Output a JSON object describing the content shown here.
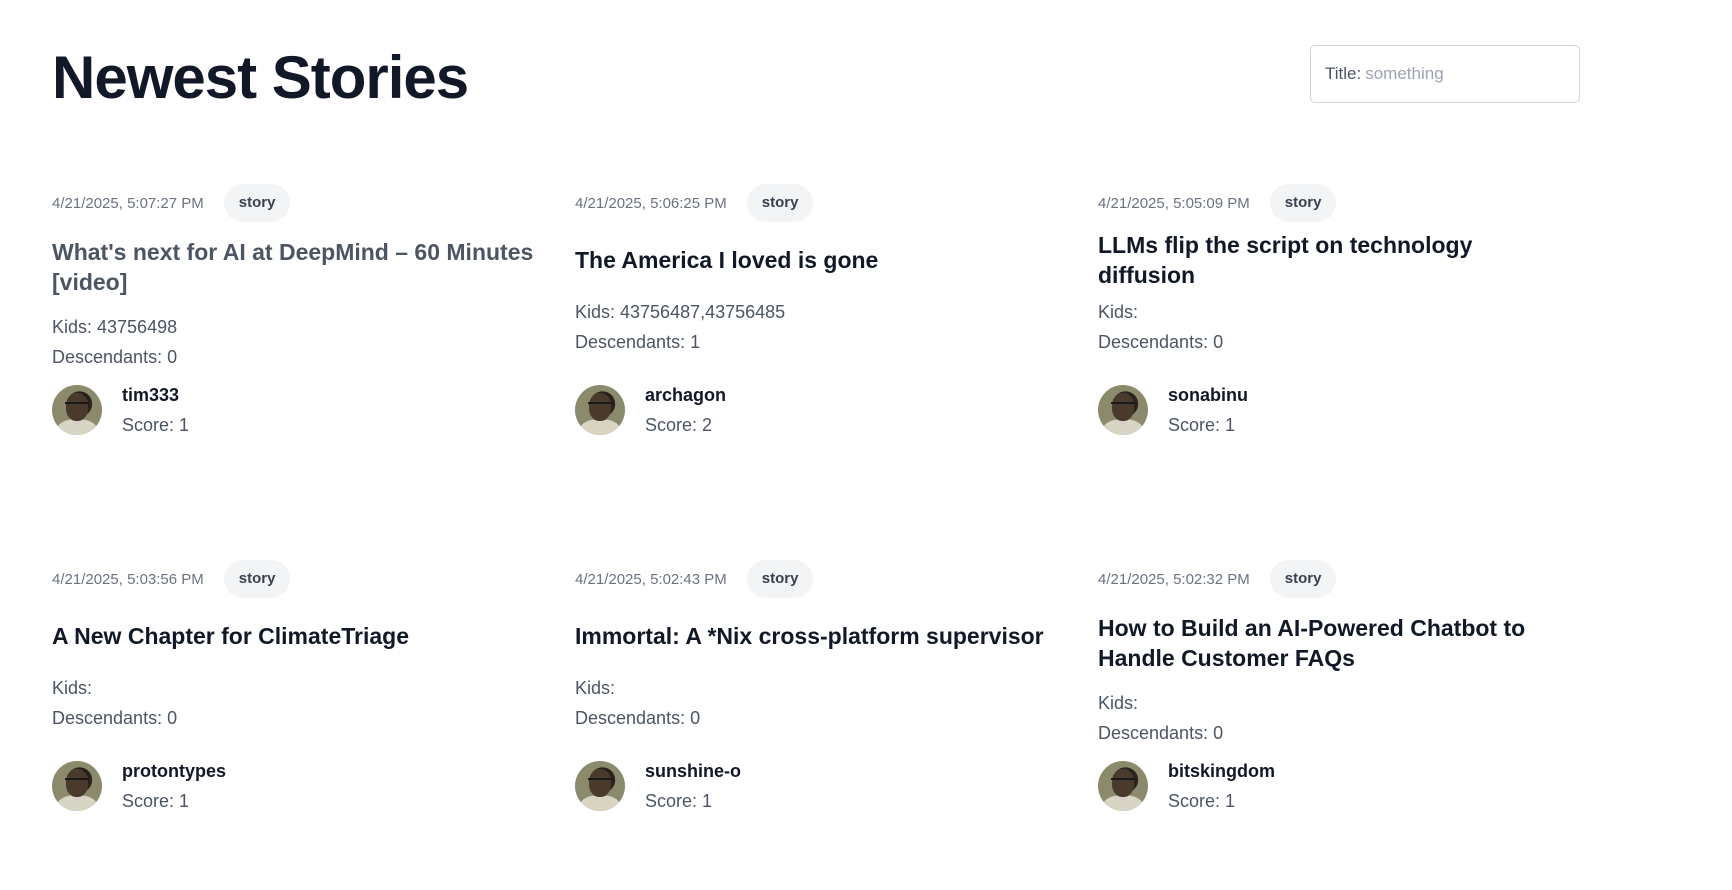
{
  "header": {
    "title": "Newest Stories",
    "search_label": "Title:",
    "search_placeholder": "something"
  },
  "stories": [
    {
      "date": "4/21/2025, 5:07:27 PM",
      "type": "story",
      "title": "What's next for AI at DeepMind – 60 Minutes [video]",
      "kids_label": "Kids: 43756498",
      "descendants_label": "Descendants: 0",
      "author": "tim333",
      "score_label": "Score: 1"
    },
    {
      "date": "4/21/2025, 5:06:25 PM",
      "type": "story",
      "title": "The America I loved is gone",
      "kids_label": "Kids: 43756487,43756485",
      "descendants_label": "Descendants: 1",
      "author": "archagon",
      "score_label": "Score: 2"
    },
    {
      "date": "4/21/2025, 5:05:09 PM",
      "type": "story",
      "title": "LLMs flip the script on technology diffusion",
      "kids_label": "Kids:",
      "descendants_label": "Descendants: 0",
      "author": "sonabinu",
      "score_label": "Score: 1"
    },
    {
      "date": "4/21/2025, 5:03:56 PM",
      "type": "story",
      "title": "A New Chapter for ClimateTriage",
      "kids_label": "Kids:",
      "descendants_label": "Descendants: 0",
      "author": "protontypes",
      "score_label": "Score: 1"
    },
    {
      "date": "4/21/2025, 5:02:43 PM",
      "type": "story",
      "title": "Immortal: A *Nix cross-platform supervisor",
      "kids_label": "Kids:",
      "descendants_label": "Descendants: 0",
      "author": "sunshine-o",
      "score_label": "Score: 1"
    },
    {
      "date": "4/21/2025, 5:02:32 PM",
      "type": "story",
      "title": "How to Build an AI-Powered Chatbot to Handle Customer FAQs",
      "kids_label": "Kids:",
      "descendants_label": "Descendants: 0",
      "author": "bitskingdom",
      "score_label": "Score: 1"
    }
  ],
  "colors": {
    "text_primary": "#111827",
    "text_secondary": "#4b5563",
    "badge_bg": "#f3f4f6"
  }
}
